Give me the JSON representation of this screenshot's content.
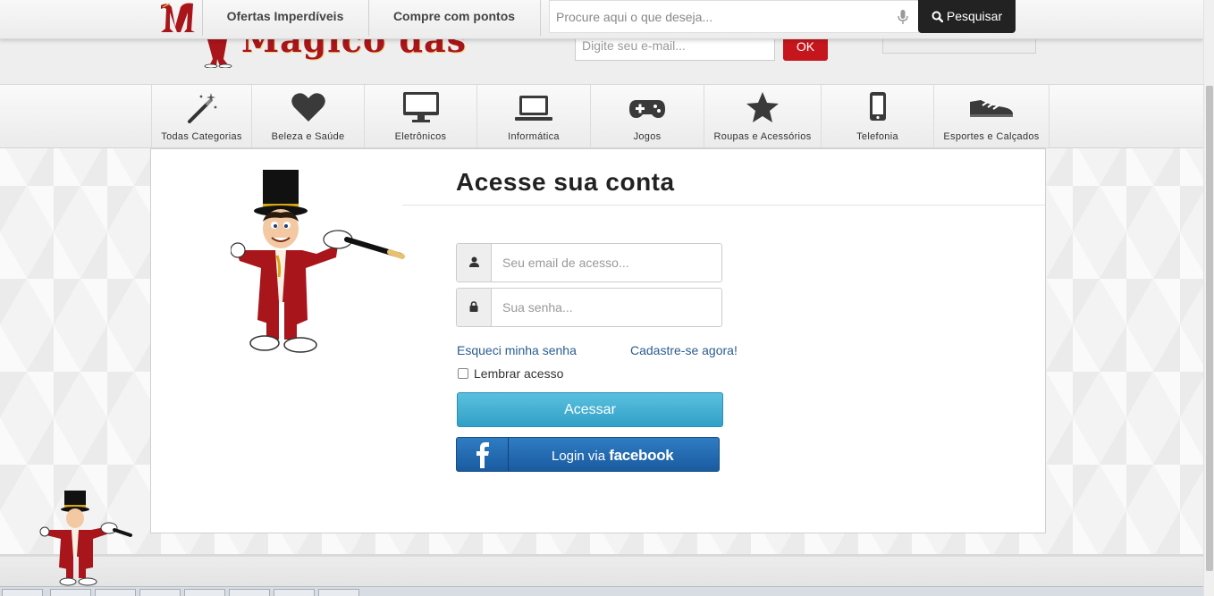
{
  "topbar": {
    "links": [
      "Ofertas Imperdíveis",
      "Compre com pontos"
    ],
    "search_placeholder": "Procure aqui o que deseja...",
    "search_button": "Pesquisar"
  },
  "header": {
    "logo_text": "Mágico das Ofertas",
    "newsletter_placeholder": "Digite seu e-mail...",
    "newsletter_button": "OK"
  },
  "categories": [
    {
      "label": "Todas Categorias",
      "icon": "magic-wand-icon"
    },
    {
      "label": "Beleza e Saúde",
      "icon": "heart-icon"
    },
    {
      "label": "Eletrônicos",
      "icon": "monitor-icon"
    },
    {
      "label": "Informática",
      "icon": "laptop-icon"
    },
    {
      "label": "Jogos",
      "icon": "gamepad-icon"
    },
    {
      "label": "Roupas e Acessórios",
      "icon": "star-icon"
    },
    {
      "label": "Telefonia",
      "icon": "smartphone-icon"
    },
    {
      "label": "Esportes e Calçados",
      "icon": "sneaker-icon"
    }
  ],
  "login": {
    "title": "Acesse sua conta",
    "email_placeholder": "Seu email de acesso...",
    "password_placeholder": "Sua senha...",
    "forgot_link": "Esqueci minha senha",
    "signup_link": "Cadastre-se agora!",
    "remember_label": "Lembrar acesso",
    "submit_button": "Acessar",
    "facebook_prefix": "Login via",
    "facebook_brand": "facebook"
  },
  "colors": {
    "brand_red": "#c4161c",
    "link_blue": "#2a5d8f",
    "accent_cyan": "#5bc0de",
    "facebook_blue": "#1a5ba0"
  }
}
